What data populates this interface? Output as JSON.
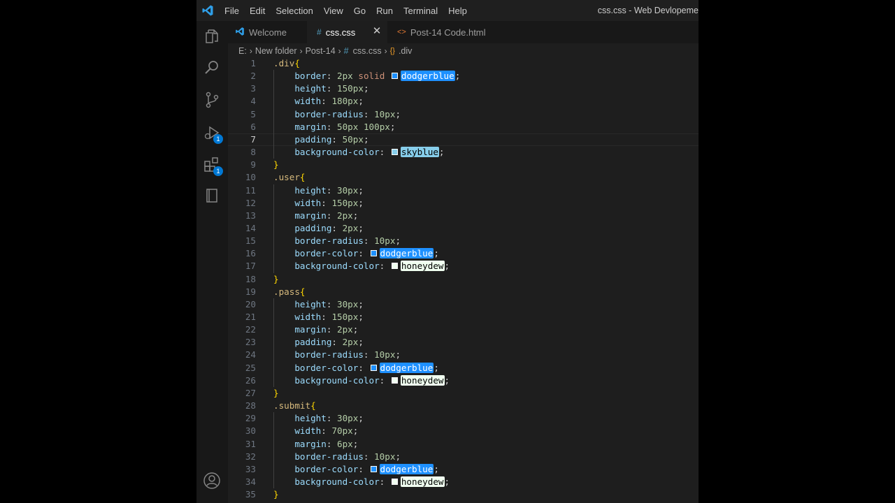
{
  "window_title": "css.css - Web Devlopeme",
  "menu": [
    "File",
    "Edit",
    "Selection",
    "View",
    "Go",
    "Run",
    "Terminal",
    "Help"
  ],
  "activity_bar": {
    "debug_badge": "1",
    "extensions_badge": "1"
  },
  "tabs": [
    {
      "label": "Welcome",
      "icon": "vscode-icon",
      "active": false
    },
    {
      "label": "css.css",
      "icon": "hash-icon",
      "active": true,
      "close": "✕"
    },
    {
      "label": "Post-14 Code.html",
      "icon": "html-brackets-icon",
      "active": false
    }
  ],
  "breadcrumb": {
    "drive": "E:",
    "folder": "New folder",
    "subfolder": "Post-14",
    "file": "css.css",
    "symbol": ".div"
  },
  "colors": {
    "dodgerblue": "#1e90ff",
    "skyblue": "#87ceeb",
    "honeydew": "#f0fff0"
  },
  "code_lines": [
    {
      "n": "1",
      "selector": ".div",
      "open": "{"
    },
    {
      "n": "2",
      "prop": "border",
      "value": "2px solid",
      "color": "dodgerblue"
    },
    {
      "n": "3",
      "prop": "height",
      "value": "150px"
    },
    {
      "n": "4",
      "prop": "width",
      "value": "180px"
    },
    {
      "n": "5",
      "prop": "border-radius",
      "value": "10px"
    },
    {
      "n": "6",
      "prop": "margin",
      "value": "50px 100px"
    },
    {
      "n": "7",
      "prop": "padding",
      "value": "50px"
    },
    {
      "n": "8",
      "prop": "background-color",
      "color": "skyblue"
    },
    {
      "n": "9",
      "close": "}"
    },
    {
      "n": "10",
      "selector": ".user",
      "open": "{"
    },
    {
      "n": "11",
      "prop": "height",
      "value": "30px"
    },
    {
      "n": "12",
      "prop": "width",
      "value": "150px"
    },
    {
      "n": "13",
      "prop": "margin",
      "value": "2px"
    },
    {
      "n": "14",
      "prop": "padding",
      "value": "2px"
    },
    {
      "n": "15",
      "prop": "border-radius",
      "value": "10px"
    },
    {
      "n": "16",
      "prop": "border-color",
      "color": "dodgerblue"
    },
    {
      "n": "17",
      "prop": "background-color",
      "color": "honeydew"
    },
    {
      "n": "18",
      "close": "}"
    },
    {
      "n": "19",
      "selector": ".pass",
      "open": "{"
    },
    {
      "n": "20",
      "prop": "height",
      "value": "30px"
    },
    {
      "n": "21",
      "prop": "width",
      "value": "150px"
    },
    {
      "n": "22",
      "prop": "margin",
      "value": "2px"
    },
    {
      "n": "23",
      "prop": "padding",
      "value": "2px"
    },
    {
      "n": "24",
      "prop": "border-radius",
      "value": "10px"
    },
    {
      "n": "25",
      "prop": "border-color",
      "color": "dodgerblue"
    },
    {
      "n": "26",
      "prop": "background-color",
      "color": "honeydew"
    },
    {
      "n": "27",
      "close": "}"
    },
    {
      "n": "28",
      "selector": ".submit",
      "open": "{"
    },
    {
      "n": "29",
      "prop": "height",
      "value": "30px"
    },
    {
      "n": "30",
      "prop": "width",
      "value": "70px"
    },
    {
      "n": "31",
      "prop": "margin",
      "value": "6px"
    },
    {
      "n": "32",
      "prop": "border-radius",
      "value": "10px"
    },
    {
      "n": "33",
      "prop": "border-color",
      "color": "dodgerblue"
    },
    {
      "n": "34",
      "prop": "background-color",
      "color": "honeydew"
    },
    {
      "n": "35",
      "close": "}"
    }
  ],
  "current_line": "7"
}
